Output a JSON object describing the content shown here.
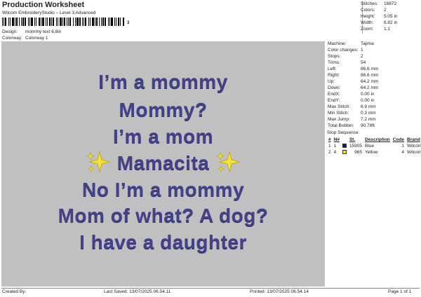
{
  "header": {
    "title": "Production Worksheet",
    "subtitle": "Wilcom EmbroideryStudio – Level 3 Advanced",
    "barcode_number": "3"
  },
  "meta": {
    "design_label": "Design:",
    "design_value": "mommy text 6,8in",
    "colorway_label": "Colorway:",
    "colorway_value": "Colorway 1"
  },
  "stats": {
    "stitches_label": "Stitches:",
    "stitches_value": "16872",
    "colors_label": "Colors:",
    "colors_value": "2",
    "height_label": "Height:",
    "height_value": "5.05 in",
    "width_label": "Width:",
    "width_value": "6.82 in",
    "zoom_label": "Zoom:",
    "zoom_value": "1:1"
  },
  "design_text": {
    "line1": "I’m a mommy",
    "line2": "Mommy?",
    "line3": "I’m a mom",
    "line4": "Mamacita",
    "line5": "No I’m a mommy",
    "line6": "Mom of what? A dog?",
    "line7": "I  have  a  daughter",
    "sparkle_color": "#f2e23a",
    "thread_color": "#43418a"
  },
  "machine": {
    "machine_label": "Machine:",
    "machine_value": "Tajima",
    "color_changes_label": "Color changes:",
    "color_changes_value": "1",
    "stops_label": "Stops:",
    "stops_value": "2",
    "trims_label": "Trims:",
    "trims_value": "54",
    "left_label": "Left:",
    "left_value": "86.6 mm",
    "right_label": "Right:",
    "right_value": "86.6 mm",
    "up_label": "Up:",
    "up_value": "64.2 mm",
    "down_label": "Down:",
    "down_value": "64.2 mm",
    "endx_label": "EndX:",
    "endx_value": "0.00 in",
    "endy_label": "EndY:",
    "endy_value": "0.00 in",
    "max_stitch_label": "Max Stitch:",
    "max_stitch_value": "6.9 mm",
    "min_stitch_label": "Min Stitch:",
    "min_stitch_value": "0.3 mm",
    "max_jump_label": "Max Jump:",
    "max_jump_value": "7.2 mm",
    "total_bobbin_label": "Total Bobbin:",
    "total_bobbin_value": "90.78ft"
  },
  "sequence": {
    "title": "Stop Sequence:",
    "headers": [
      "#",
      "N#",
      "",
      "St.",
      "Description",
      "Code",
      "Brand"
    ],
    "rows": [
      {
        "num": "1",
        "n": "1",
        "swatch": "#1c1a4f",
        "st": "15905",
        "desc": "Blue",
        "code": "1",
        "brand": "Wilcom"
      },
      {
        "num": "2",
        "n": "4",
        "swatch": "#f3e600",
        "st": "965",
        "desc": "Yellow",
        "code": "4",
        "brand": "Wilcom"
      }
    ]
  },
  "footer": {
    "created_by": "Created By:",
    "last_saved": "Last Saved: 13/07/2025 06.54.11",
    "printed": "Printed: 13/07/2025 06.54.14",
    "page": "Page 1 of 1"
  }
}
